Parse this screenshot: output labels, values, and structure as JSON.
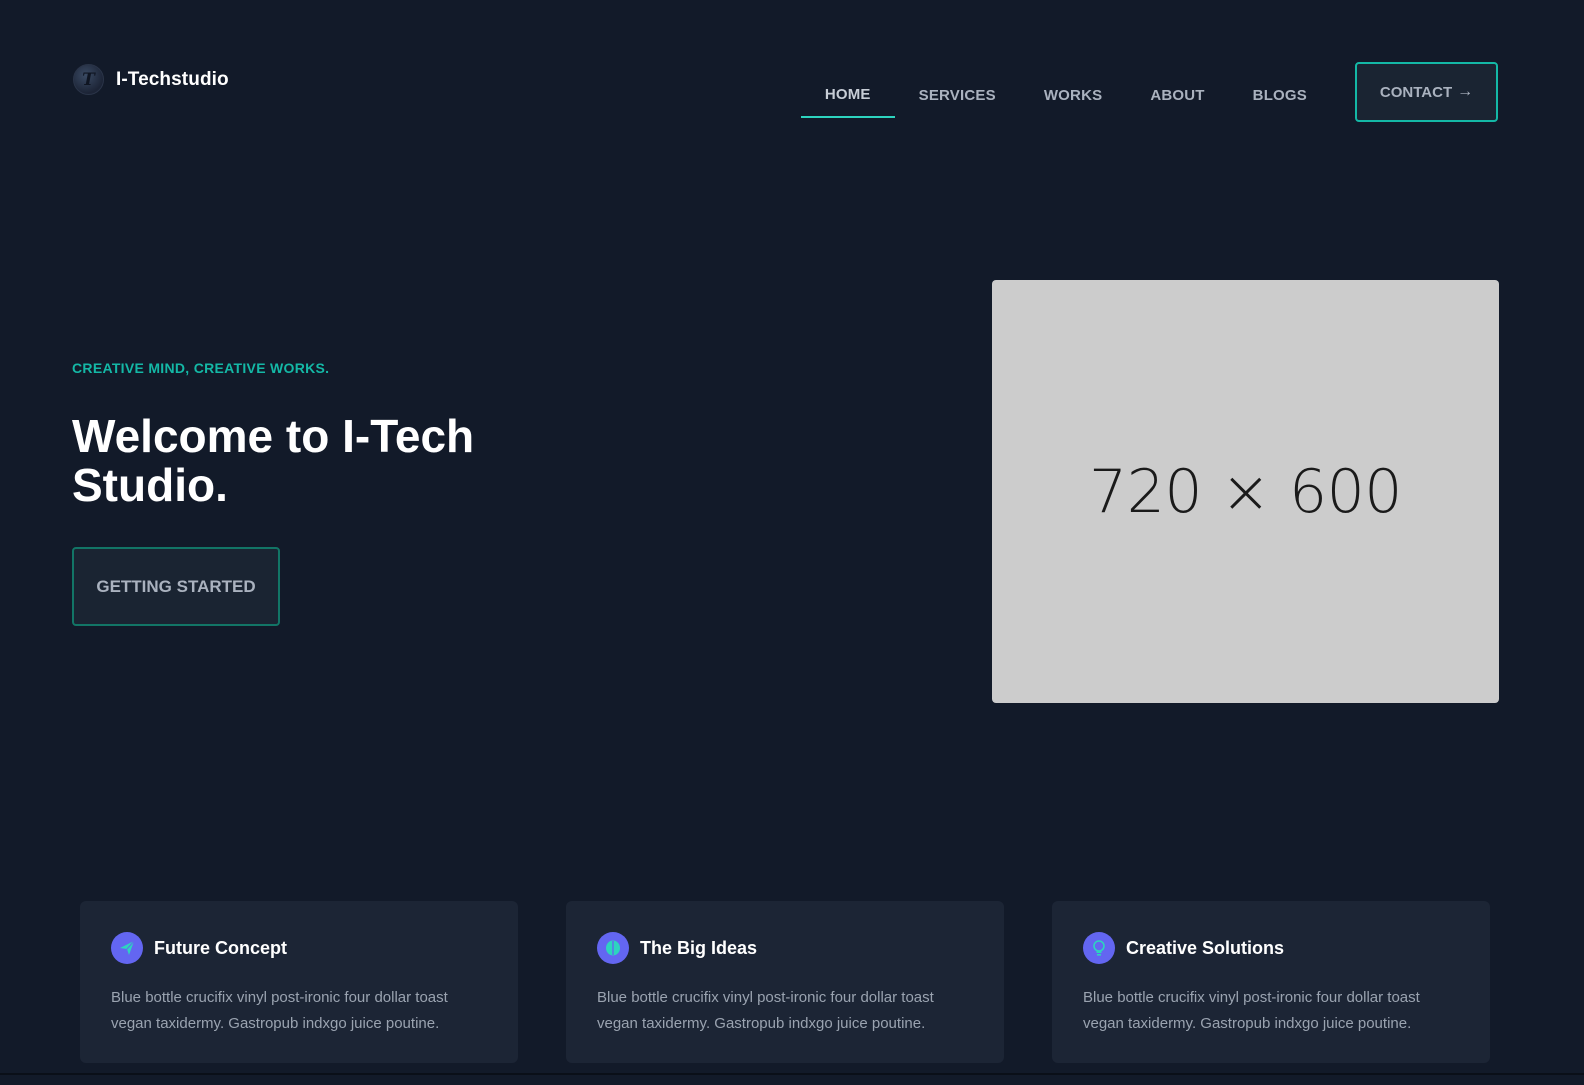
{
  "header": {
    "brand_logo_letter": "T",
    "brand_name": "I-Techstudio",
    "nav": [
      "HOME",
      "SERVICES",
      "WORKS",
      "ABOUT",
      "BLOGS"
    ],
    "active_nav": "HOME",
    "contact_label": "CONTACT",
    "contact_arrow": "→"
  },
  "hero": {
    "tagline": "CREATIVE MIND, CREATIVE WORKS.",
    "title": "Welcome to I-Tech Studio.",
    "cta_label": "GETTING STARTED",
    "image_placeholder": "720 × 600"
  },
  "features": [
    {
      "title": "Future Concept",
      "icon": "paper-plane-icon",
      "text": "Blue bottle crucifix vinyl post-ironic four dollar toast vegan taxidermy. Gastropub indxgo juice poutine."
    },
    {
      "title": "The Big Ideas",
      "icon": "brain-icon",
      "text": "Blue bottle crucifix vinyl post-ironic four dollar toast vegan taxidermy. Gastropub indxgo juice poutine."
    },
    {
      "title": "Creative Solutions",
      "icon": "lightbulb-icon",
      "text": "Blue bottle crucifix vinyl post-ironic four dollar toast vegan taxidermy. Gastropub indxgo juice poutine."
    }
  ],
  "colors": {
    "background": "#121a29",
    "accent_teal": "#14b8a6",
    "icon_bg": "#6366f1",
    "card_bg": "#1c2535"
  }
}
